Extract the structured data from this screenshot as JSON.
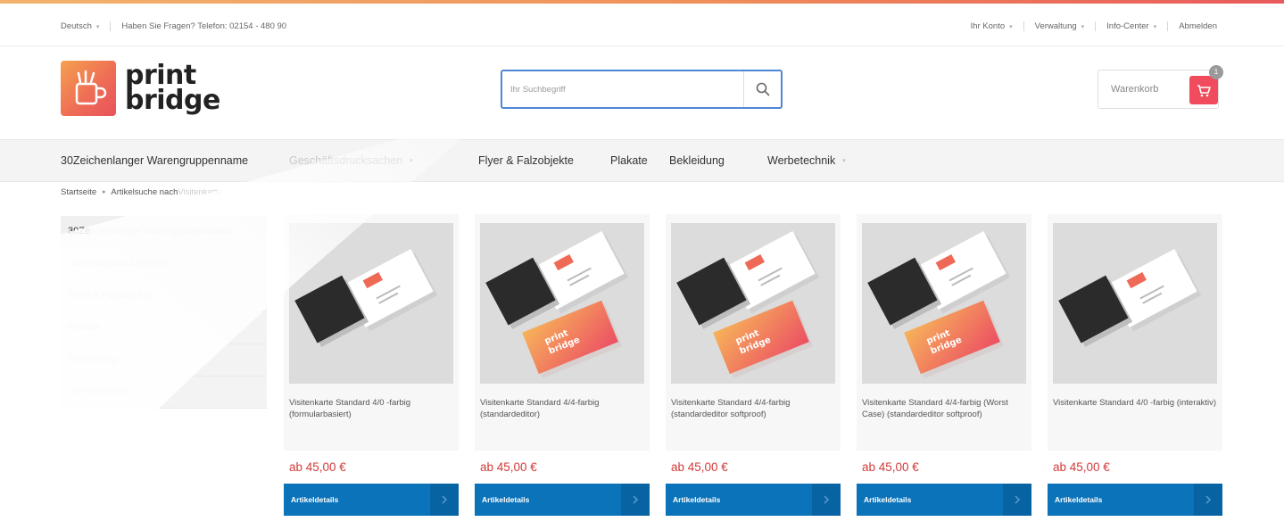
{
  "topbar": {
    "language": "Deutsch",
    "contact": "Haben Sie Fragen? Telefon: 02154 - 480 90",
    "account": "Ihr Konto",
    "admin": "Verwaltung",
    "info": "Info-Center",
    "logout": "Abmelden"
  },
  "logo": {
    "line1": "print",
    "line2": "bridge"
  },
  "search": {
    "placeholder": "Ihr Suchbegriff"
  },
  "cart": {
    "label": "Warenkorb",
    "count": "1"
  },
  "nav": {
    "items": [
      {
        "label": "30Zeichenlanger Warengruppenname"
      },
      {
        "label": "Geschäftsdrucksachen"
      },
      {
        "label": "Flyer & Falzobjekte"
      },
      {
        "label": "Plakate"
      },
      {
        "label": "Bekleidung"
      },
      {
        "label": "Werbetechnik"
      }
    ]
  },
  "breadcrumb": {
    "home": "Startseite",
    "search_prefix": "Artikelsuche nach ",
    "term": "Visitenkarte"
  },
  "sidebar": {
    "items": [
      {
        "label": "30Zeichenlanger Warengruppenname",
        "visible": "30Ze",
        "faded": "ichenlanger Warengruppenname"
      },
      {
        "label": "Geschäftsdrucksachen"
      },
      {
        "label": "Flyer & Falzobjekte"
      },
      {
        "label": "Plakate"
      },
      {
        "label": "Bekleidung"
      },
      {
        "label": "Werbetechnik"
      }
    ]
  },
  "products": [
    {
      "title": "Visitenkarte Standard 4/0 -farbig (formularbasiert)",
      "price": "ab 45,00 €",
      "button": "Artikeldetails",
      "variant": "single"
    },
    {
      "title": "Visitenkarte Standard 4/4-farbig (standardeditor)",
      "price": "ab 45,00 €",
      "button": "Artikeldetails",
      "variant": "double"
    },
    {
      "title": "Visitenkarte Standard 4/4-farbig (standardeditor softproof)",
      "price": "ab 45,00 €",
      "button": "Artikeldetails",
      "variant": "double"
    },
    {
      "title": "Visitenkarte Standard 4/4-farbig (Worst Case) (standardeditor softproof)",
      "price": "ab 45,00 €",
      "button": "Artikeldetails",
      "variant": "double"
    },
    {
      "title": "Visitenkarte Standard 4/0 -farbig (interaktiv)",
      "price": "ab 45,00 €",
      "button": "Artikeldetails",
      "variant": "single"
    }
  ],
  "colors": {
    "accent_blue": "#0a73ba",
    "price_red": "#d23a3a",
    "cart_red": "#f04c5d",
    "search_border": "#4f86d6"
  },
  "icons": {
    "search": "search-icon",
    "cart": "cart-icon",
    "chevron": "chevron-down-icon",
    "arrow": "chevron-right-icon"
  }
}
